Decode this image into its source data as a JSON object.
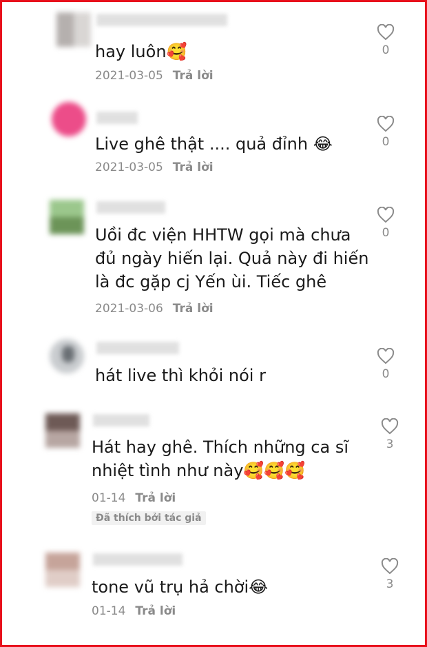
{
  "comments": [
    {
      "text": "hay luôn🥰",
      "date": "2021-03-05",
      "reply": "Trả lời",
      "likes": "0"
    },
    {
      "text": "Live ghê thật .... quả đỉnh 😂",
      "date": "2021-03-05",
      "reply": "Trả lời",
      "likes": "0"
    },
    {
      "text": "Uồi đc viện HHTW gọi mà chưa\nđủ ngày hiến lại. Quả này đi hiến\nlà đc gặp cj Yến ùi. Tiếc ghê",
      "date": "2021-03-06",
      "reply": "Trả lời",
      "likes": "0"
    },
    {
      "text": "hát live thì khỏi nói r",
      "likes": "0"
    },
    {
      "text": "Hát hay ghê. Thích những ca sĩ\nnhiệt tình như này🥰🥰🥰",
      "date": "01-14",
      "reply": "Trả lời",
      "badge": "Đã thích bởi tác giả",
      "likes": "3"
    },
    {
      "text": "tone vũ trụ hả chời😂",
      "date": "01-14",
      "reply": "Trả lời",
      "likes": "3"
    }
  ],
  "colors": {
    "border": "#e8101c",
    "muted": "#8a8a8a",
    "text": "#1a1a1a"
  },
  "icons": {
    "like": "heart-outline-icon"
  }
}
